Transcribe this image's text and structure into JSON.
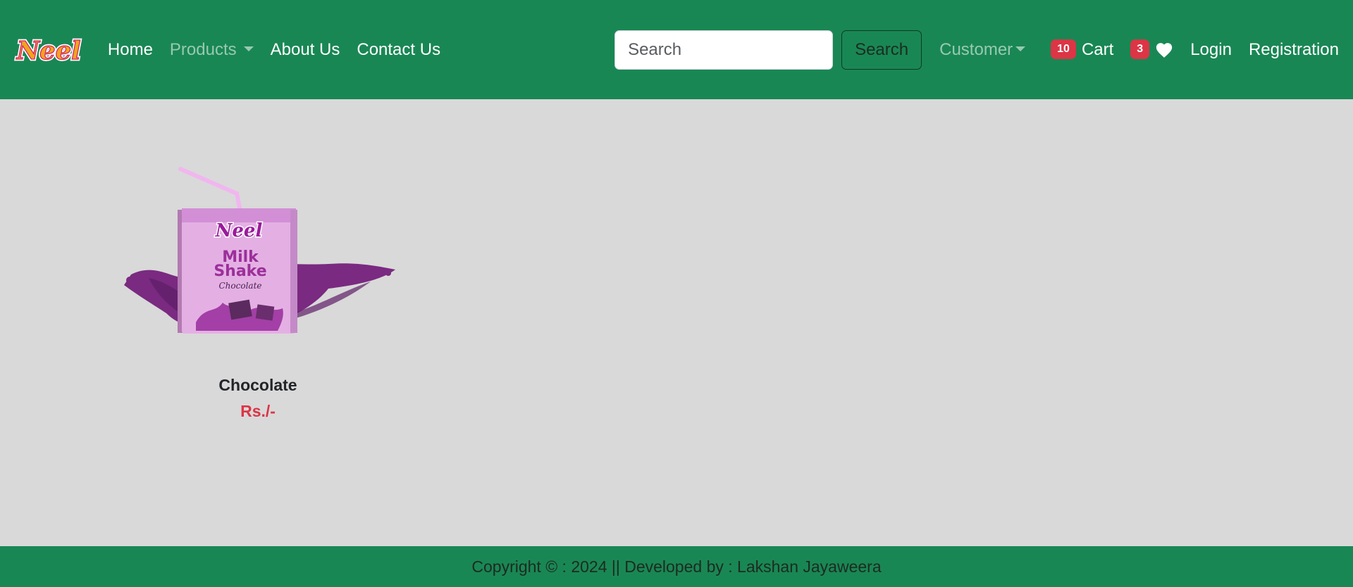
{
  "brand": {
    "logo_text": "Neel"
  },
  "nav": {
    "home": "Home",
    "products": "Products",
    "about": "About Us",
    "contact": "Contact Us"
  },
  "search": {
    "placeholder": "Search",
    "value": "",
    "button_label": "Search"
  },
  "customer_menu": {
    "label": "Customer"
  },
  "cart": {
    "count": "10",
    "label": "Cart"
  },
  "wishlist": {
    "count": "3",
    "icon": "heart-icon"
  },
  "auth": {
    "login": "Login",
    "registration": "Registration"
  },
  "products": [
    {
      "name": "Chocolate",
      "price": "Rs./-",
      "image_text": {
        "brand": "Neel",
        "line1": "Milk",
        "line2": "Shake",
        "flavor": "Chocolate"
      }
    }
  ],
  "footer": {
    "text": "Copyright © : 2024 || Developed by : Lakshan Jayaweera"
  },
  "colors": {
    "navbar": "#198754",
    "background": "#d9d9d9",
    "badge": "#dc3545",
    "price": "#dc3545"
  }
}
